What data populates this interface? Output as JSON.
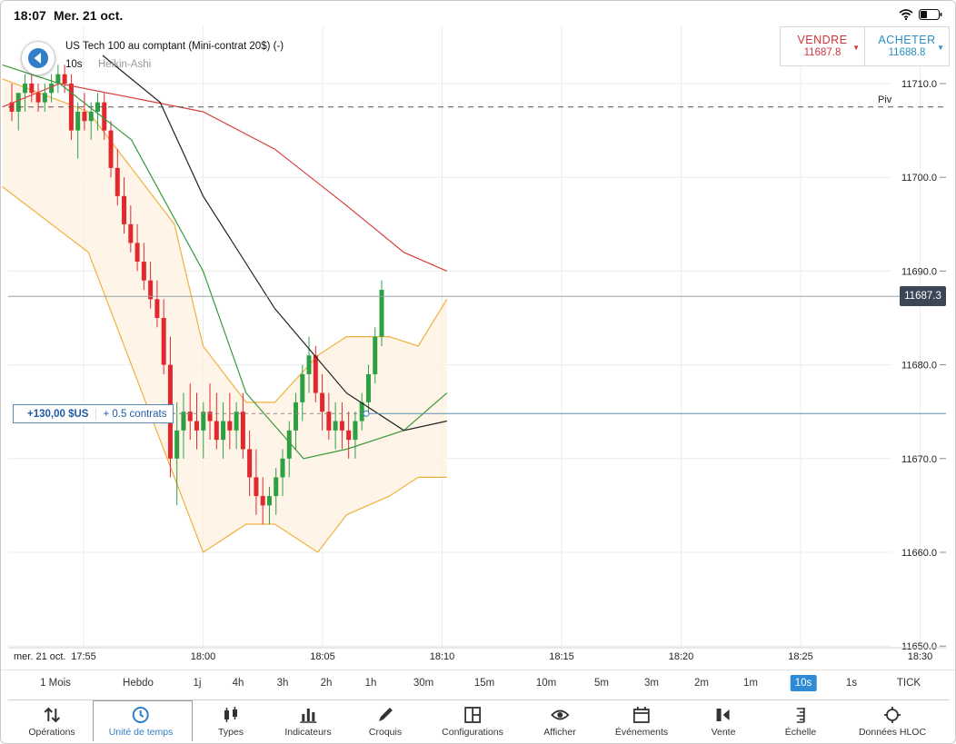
{
  "status_bar": {
    "time": "18:07",
    "date": "Mer. 21 oct."
  },
  "instrument": {
    "name": "US Tech 100 au comptant (Mini-contrat 20$) (-)",
    "interval": "10s",
    "chart_type": "Heikin-Ashi"
  },
  "trade_panel": {
    "sell_label": "VENDRE",
    "sell_price": "11687.8",
    "buy_label": "ACHETER",
    "buy_price": "11688.8",
    "sell_color": "#d0343a",
    "buy_color": "#2a8ec2"
  },
  "current_price_tag": "11687.3",
  "pivot_label": "Piv",
  "position": {
    "pnl": "+130,00 $US",
    "size": "+ 0.5 contrats"
  },
  "chart_data": {
    "type": "candlestick",
    "y_axis": {
      "ticks": [
        "11710.0",
        "11700.0",
        "11690.0",
        "11680.0",
        "11670.0",
        "11660.0",
        "11650.0"
      ],
      "range": [
        11650,
        11712
      ]
    },
    "x_axis": {
      "date_label": "mer. 21 oct.",
      "ticks": [
        "17:55",
        "18:00",
        "18:05",
        "18:10",
        "18:15",
        "18:20",
        "18:25",
        "18:30"
      ]
    },
    "pivot_level": 11707.5,
    "current_price": 11687.3,
    "position_entry": 11674.8,
    "up_color": "#2ea043",
    "down_color": "#e0282e",
    "candles_10s": [
      {
        "o": 11708,
        "h": 11710,
        "l": 11706,
        "c": 11707
      },
      {
        "o": 11707,
        "h": 11709,
        "l": 11705,
        "c": 11709
      },
      {
        "o": 11709,
        "h": 11711,
        "l": 11707,
        "c": 11710
      },
      {
        "o": 11710,
        "h": 11711,
        "l": 11708,
        "c": 11709
      },
      {
        "o": 11709,
        "h": 11710,
        "l": 11707,
        "c": 11708
      },
      {
        "o": 11708,
        "h": 11710,
        "l": 11707,
        "c": 11709
      },
      {
        "o": 11709,
        "h": 11711,
        "l": 11708,
        "c": 11710
      },
      {
        "o": 11710,
        "h": 11712,
        "l": 11709,
        "c": 11711
      },
      {
        "o": 11711,
        "h": 11712,
        "l": 11709,
        "c": 11710
      },
      {
        "o": 11710,
        "h": 11711,
        "l": 11704,
        "c": 11705
      },
      {
        "o": 11705,
        "h": 11708,
        "l": 11702,
        "c": 11707
      },
      {
        "o": 11707,
        "h": 11709,
        "l": 11705,
        "c": 11706
      },
      {
        "o": 11706,
        "h": 11708,
        "l": 11704,
        "c": 11707
      },
      {
        "o": 11707,
        "h": 11709,
        "l": 11705,
        "c": 11708
      },
      {
        "o": 11708,
        "h": 11709,
        "l": 11704,
        "c": 11705
      },
      {
        "o": 11705,
        "h": 11706,
        "l": 11700,
        "c": 11701
      },
      {
        "o": 11701,
        "h": 11703,
        "l": 11697,
        "c": 11698
      },
      {
        "o": 11698,
        "h": 11700,
        "l": 11694,
        "c": 11695
      },
      {
        "o": 11695,
        "h": 11697,
        "l": 11692,
        "c": 11693
      },
      {
        "o": 11693,
        "h": 11695,
        "l": 11690,
        "c": 11691
      },
      {
        "o": 11691,
        "h": 11693,
        "l": 11688,
        "c": 11689
      },
      {
        "o": 11689,
        "h": 11691,
        "l": 11686,
        "c": 11687
      },
      {
        "o": 11687,
        "h": 11689,
        "l": 11684,
        "c": 11685
      },
      {
        "o": 11685,
        "h": 11687,
        "l": 11679,
        "c": 11680
      },
      {
        "o": 11680,
        "h": 11683,
        "l": 11668,
        "c": 11670
      },
      {
        "o": 11670,
        "h": 11676,
        "l": 11665,
        "c": 11673
      },
      {
        "o": 11673,
        "h": 11677,
        "l": 11670,
        "c": 11675
      },
      {
        "o": 11675,
        "h": 11678,
        "l": 11672,
        "c": 11674
      },
      {
        "o": 11674,
        "h": 11677,
        "l": 11671,
        "c": 11673
      },
      {
        "o": 11673,
        "h": 11676,
        "l": 11670,
        "c": 11675
      },
      {
        "o": 11675,
        "h": 11678,
        "l": 11672,
        "c": 11674
      },
      {
        "o": 11674,
        "h": 11677,
        "l": 11671,
        "c": 11672
      },
      {
        "o": 11672,
        "h": 11676,
        "l": 11670,
        "c": 11674
      },
      {
        "o": 11674,
        "h": 11677,
        "l": 11671,
        "c": 11673
      },
      {
        "o": 11673,
        "h": 11676,
        "l": 11671,
        "c": 11675
      },
      {
        "o": 11675,
        "h": 11677,
        "l": 11670,
        "c": 11671
      },
      {
        "o": 11671,
        "h": 11673,
        "l": 11666,
        "c": 11668
      },
      {
        "o": 11668,
        "h": 11671,
        "l": 11664,
        "c": 11666
      },
      {
        "o": 11666,
        "h": 11668,
        "l": 11663,
        "c": 11665
      },
      {
        "o": 11665,
        "h": 11667,
        "l": 11663,
        "c": 11666
      },
      {
        "o": 11666,
        "h": 11669,
        "l": 11664,
        "c": 11668
      },
      {
        "o": 11668,
        "h": 11671,
        "l": 11666,
        "c": 11670
      },
      {
        "o": 11670,
        "h": 11674,
        "l": 11668,
        "c": 11673
      },
      {
        "o": 11673,
        "h": 11677,
        "l": 11671,
        "c": 11676
      },
      {
        "o": 11676,
        "h": 11680,
        "l": 11674,
        "c": 11679
      },
      {
        "o": 11679,
        "h": 11683,
        "l": 11677,
        "c": 11681
      },
      {
        "o": 11681,
        "h": 11682,
        "l": 11676,
        "c": 11677
      },
      {
        "o": 11677,
        "h": 11679,
        "l": 11673,
        "c": 11675
      },
      {
        "o": 11675,
        "h": 11677,
        "l": 11672,
        "c": 11673
      },
      {
        "o": 11673,
        "h": 11676,
        "l": 11671,
        "c": 11674
      },
      {
        "o": 11674,
        "h": 11676,
        "l": 11671,
        "c": 11673
      },
      {
        "o": 11673,
        "h": 11675,
        "l": 11670,
        "c": 11672
      },
      {
        "o": 11672,
        "h": 11675,
        "l": 11670,
        "c": 11674
      },
      {
        "o": 11674,
        "h": 11677,
        "l": 11673,
        "c": 11676
      },
      {
        "o": 11676,
        "h": 11680,
        "l": 11675,
        "c": 11679
      },
      {
        "o": 11679,
        "h": 11684,
        "l": 11678,
        "c": 11683
      },
      {
        "o": 11683,
        "h": 11689,
        "l": 11682,
        "c": 11688
      }
    ],
    "bollinger_upper": [
      [
        17.86,
        11710.5
      ],
      [
        17.92,
        11707
      ],
      [
        17.98,
        11695
      ],
      [
        18.0,
        11682
      ],
      [
        18.03,
        11676
      ],
      [
        18.05,
        11676
      ],
      [
        18.08,
        11681
      ],
      [
        18.1,
        11683
      ],
      [
        18.13,
        11683
      ],
      [
        18.15,
        11682
      ],
      [
        18.17,
        11687
      ]
    ],
    "bollinger_lower": [
      [
        17.86,
        11699
      ],
      [
        17.92,
        11692
      ],
      [
        17.98,
        11668
      ],
      [
        18.0,
        11660
      ],
      [
        18.03,
        11663
      ],
      [
        18.05,
        11663
      ],
      [
        18.08,
        11660
      ],
      [
        18.1,
        11664
      ],
      [
        18.13,
        11666
      ],
      [
        18.15,
        11668
      ],
      [
        18.17,
        11668
      ]
    ],
    "ma_green": [
      [
        17.86,
        11712
      ],
      [
        17.9,
        11710
      ],
      [
        17.95,
        11704
      ],
      [
        18.0,
        11690
      ],
      [
        18.03,
        11677
      ],
      [
        18.07,
        11670
      ],
      [
        18.1,
        11671
      ],
      [
        18.14,
        11673
      ],
      [
        18.17,
        11677
      ]
    ],
    "ma_black": [
      [
        17.93,
        11713
      ],
      [
        17.97,
        11708
      ],
      [
        18.0,
        11698
      ],
      [
        18.05,
        11686
      ],
      [
        18.1,
        11677
      ],
      [
        18.14,
        11673
      ],
      [
        18.17,
        11674
      ]
    ],
    "ma_red": [
      [
        17.86,
        11707.5
      ],
      [
        17.9,
        11710
      ],
      [
        18.0,
        11707
      ],
      [
        18.05,
        11703
      ],
      [
        18.1,
        11697
      ],
      [
        18.14,
        11692
      ],
      [
        18.17,
        11690
      ]
    ]
  },
  "timeframes": [
    "1 Mois",
    "Hebdo",
    "1j",
    "4h",
    "3h",
    "2h",
    "1h",
    "30m",
    "15m",
    "10m",
    "5m",
    "3m",
    "2m",
    "1m",
    "10s",
    "1s",
    "TICK"
  ],
  "active_timeframe": "10s",
  "toolbar": [
    {
      "label": "Opérations",
      "icon": "sort-arrows-icon"
    },
    {
      "label": "Unité de temps",
      "icon": "clock-icon"
    },
    {
      "label": "Types",
      "icon": "candles-icon"
    },
    {
      "label": "Indicateurs",
      "icon": "bar-chart-icon"
    },
    {
      "label": "Croquis",
      "icon": "pencil-icon"
    },
    {
      "label": "Configurations",
      "icon": "layout-grid-icon"
    },
    {
      "label": "Afficher",
      "icon": "eye-icon"
    },
    {
      "label": "Événements",
      "icon": "calendar-icon"
    },
    {
      "label": "Vente",
      "icon": "sell-icon"
    },
    {
      "label": "Échelle",
      "icon": "scale-icon"
    },
    {
      "label": "Données HLOC",
      "icon": "crosshair-icon"
    }
  ],
  "active_toolbar": "Unité de temps"
}
